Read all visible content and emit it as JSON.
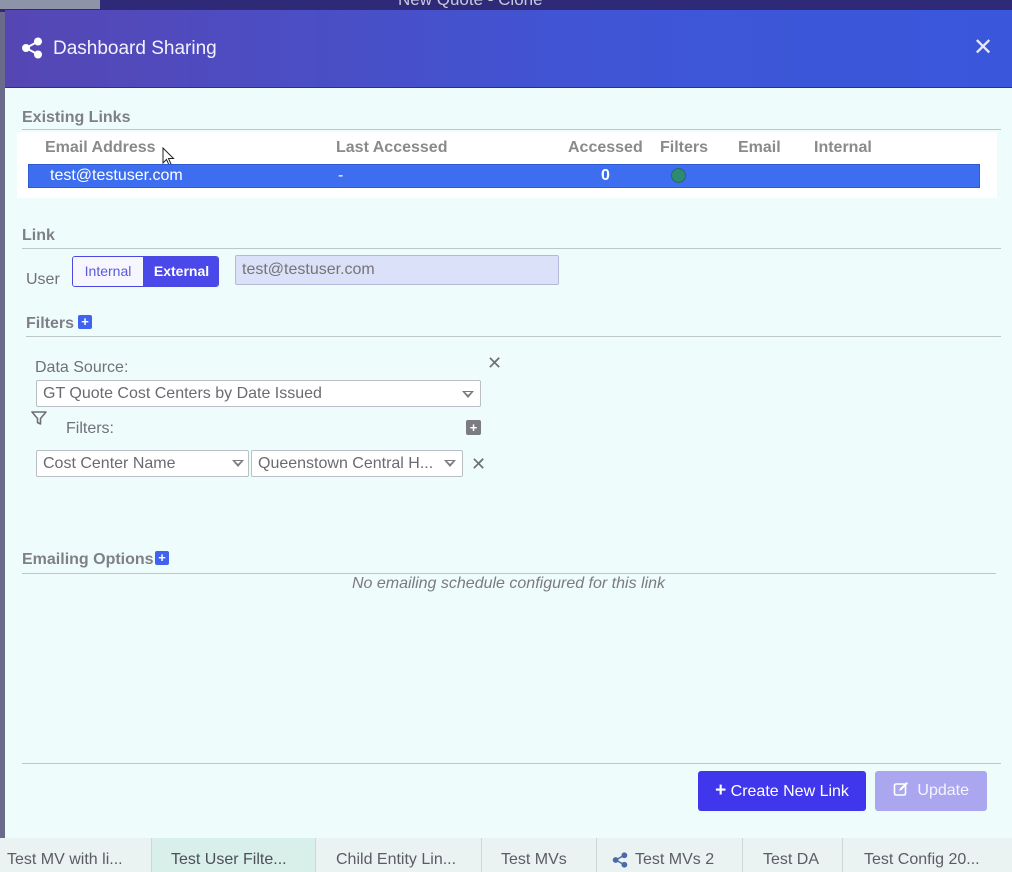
{
  "background": {
    "title": "New Quote - Clone"
  },
  "modal": {
    "title": "Dashboard Sharing",
    "close": "✕"
  },
  "existing_links": {
    "title": "Existing Links",
    "headers": [
      "Email Address",
      "Last Accessed",
      "Accessed",
      "Filters",
      "Email",
      "Internal"
    ],
    "rows": [
      {
        "email": "test@testuser.com",
        "last_accessed": "-",
        "accessed": "0",
        "filters_indicator_color": "#2e8a72"
      }
    ]
  },
  "link": {
    "title": "Link",
    "user_label": "User",
    "toggle": {
      "internal": "Internal",
      "external": "External",
      "selected": "External"
    },
    "user_email_placeholder": "test@testuser.com"
  },
  "filters": {
    "title": "Filters",
    "data_source_label": "Data Source:",
    "data_source_value": "GT Quote Cost Centers by Date Issued",
    "filters_label": "Filters:",
    "rules": [
      {
        "field": "Cost Center Name",
        "value": "Queenstown Central H..."
      }
    ]
  },
  "emailing": {
    "title": "Emailing Options",
    "empty_message": "No emailing schedule configured for this link"
  },
  "buttons": {
    "create": "Create New Link",
    "update": "Update"
  },
  "bottom_tabs": [
    "Test MV with li...",
    "Test User Filte...",
    "Child Entity Lin...",
    "Test MVs",
    "Test MVs 2",
    "Test DA",
    "Test Config 20..."
  ],
  "colors": {
    "accent": "#4037ec",
    "row_selected": "#3d6ef0",
    "header_gradient_start": "#5646b4",
    "header_gradient_end": "#3a57dc"
  }
}
